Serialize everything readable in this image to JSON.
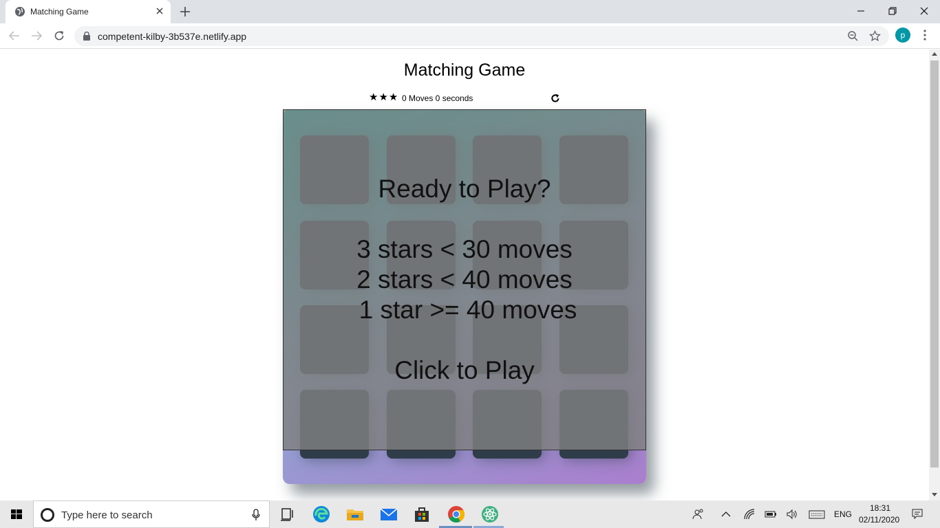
{
  "browser": {
    "tab_title": "Matching Game",
    "url": "competent-kilby-3b537e.netlify.app",
    "profile_initial": "p"
  },
  "game": {
    "title": "Matching Game",
    "stars": "★★★",
    "moves_text": "0 Moves 0 seconds",
    "overlay": {
      "line1": "Ready to Play?",
      "line2": "3 stars < 30 moves",
      "line3": "2 stars < 40 moves",
      "line4": "1 star >= 40 moves",
      "line5": "Click to Play"
    },
    "card_count": 16
  },
  "taskbar": {
    "search_placeholder": "Type here to search",
    "language": "ENG",
    "time": "18:31",
    "date": "02/11/2020"
  },
  "colors": {
    "deck_gradient_start": "#02ccba",
    "deck_gradient_end": "#aa7ecd",
    "card_back": "#2e3d49",
    "profile_bg": "#0097a7"
  }
}
